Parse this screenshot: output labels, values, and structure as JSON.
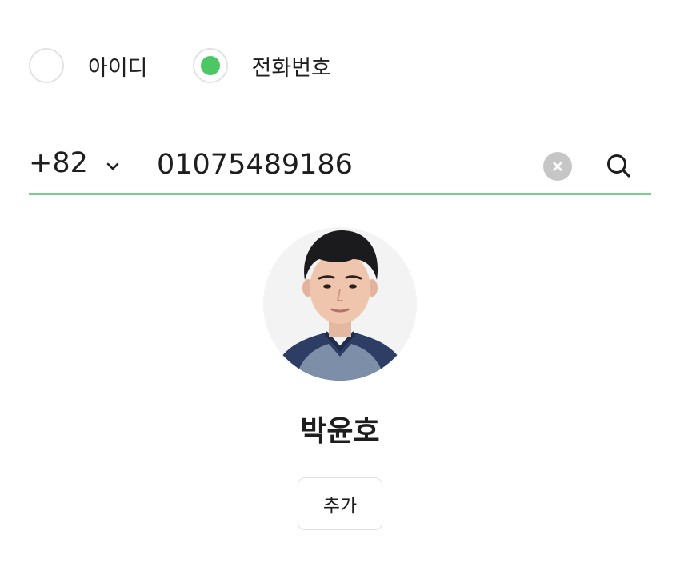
{
  "search_type": {
    "options": [
      {
        "label": "아이디",
        "selected": false
      },
      {
        "label": "전화번호",
        "selected": true
      }
    ]
  },
  "phone_search": {
    "country_code": "+82",
    "value": "01075489186",
    "clear_icon": "clear-icon",
    "search_icon": "search-icon"
  },
  "result": {
    "name": "박윤호",
    "add_label": "추가"
  },
  "colors": {
    "accent": "#4cc764",
    "underline": "#7bcf8a",
    "text": "#1e1e1e",
    "clear_bg": "#c6c6c6"
  }
}
